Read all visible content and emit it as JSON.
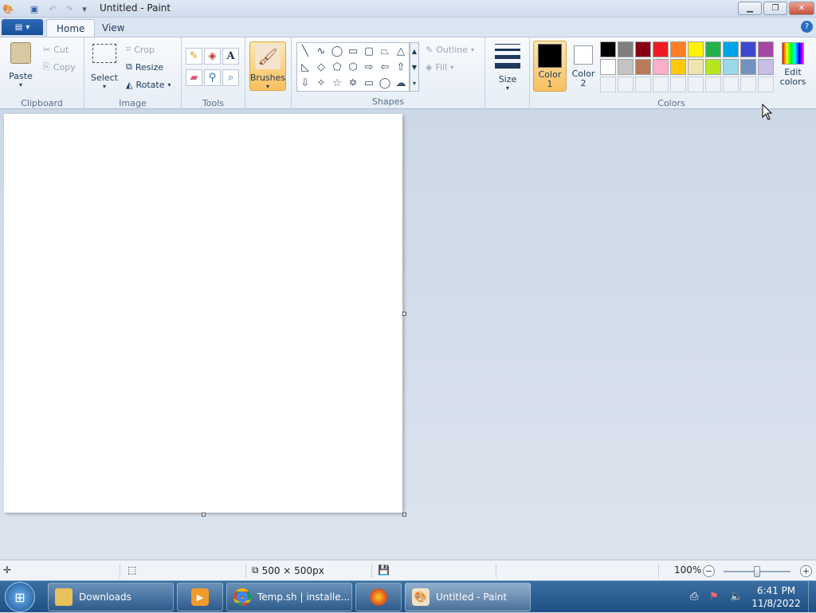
{
  "window": {
    "title": "Untitled - Paint"
  },
  "tabs": {
    "home": "Home",
    "view": "View"
  },
  "clipboard": {
    "paste": "Paste",
    "cut": "Cut",
    "copy": "Copy",
    "label": "Clipboard"
  },
  "image": {
    "select": "Select",
    "crop": "Crop",
    "resize": "Resize",
    "rotate": "Rotate",
    "label": "Image"
  },
  "tools": {
    "label": "Tools"
  },
  "brushes": {
    "label": "Brushes"
  },
  "shapes": {
    "outline": "Outline",
    "fill": "Fill",
    "label": "Shapes"
  },
  "size": {
    "label": "Size"
  },
  "colors": {
    "color1_line1": "Color",
    "color1_line2": "1",
    "color2_line1": "Color",
    "color2_line2": "2",
    "edit_line1": "Edit",
    "edit_line2": "colors",
    "label": "Colors",
    "color1_value": "#000000",
    "color2_value": "#ffffff",
    "palette_row1": [
      "#000000",
      "#7f7f7f",
      "#880015",
      "#ed1c24",
      "#ff7f27",
      "#fff200",
      "#22b14c",
      "#00a2e8",
      "#3f48cc",
      "#a349a4"
    ],
    "palette_row2": [
      "#ffffff",
      "#c3c3c3",
      "#b97a57",
      "#ffaec9",
      "#ffc90e",
      "#efe4b0",
      "#b5e61d",
      "#99d9ea",
      "#7092be",
      "#c8bfe7"
    ]
  },
  "status": {
    "canvas_size": "500 × 500px",
    "zoom": "100%"
  },
  "taskbar": {
    "downloads": "Downloads",
    "chrome": "Temp.sh | installe...",
    "paint": "Untitled - Paint",
    "time": "6:41 PM",
    "date": "11/8/2022"
  }
}
